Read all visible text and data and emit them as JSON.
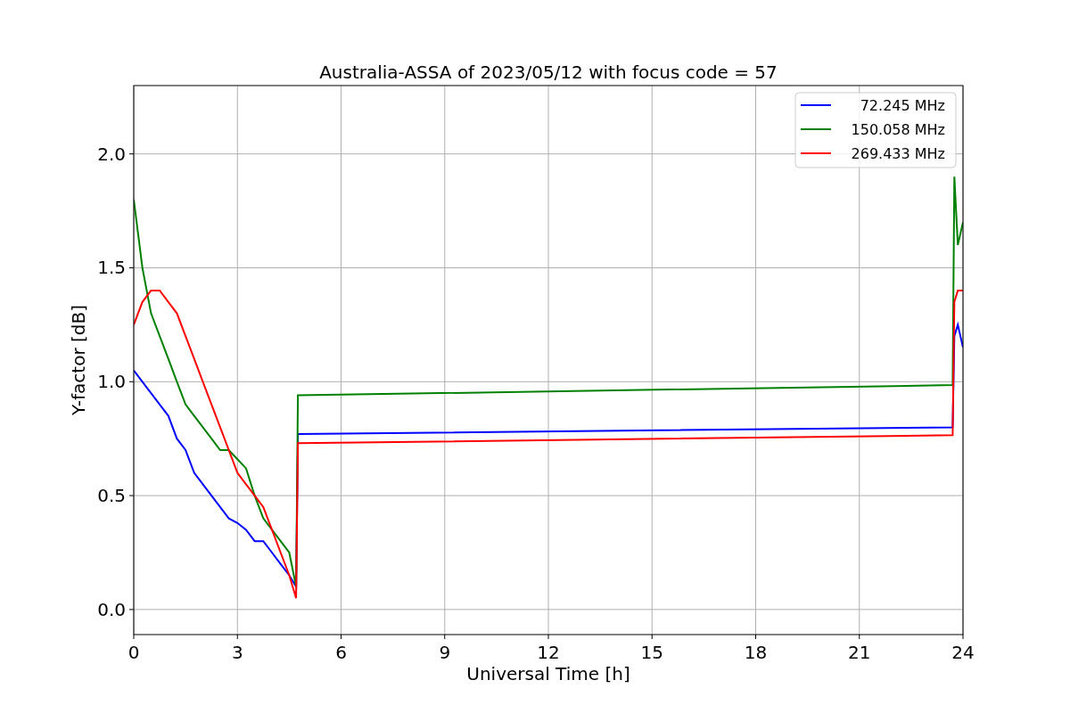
{
  "chart_data": {
    "type": "line",
    "title": "Australia-ASSA of 2023/05/12 with focus code = 57",
    "xlabel": "Universal Time [h]",
    "ylabel": "Y-factor [dB]",
    "x": [
      0,
      0.25,
      0.5,
      0.75,
      1,
      1.25,
      1.5,
      1.75,
      2,
      2.25,
      2.5,
      2.75,
      3,
      3.25,
      3.5,
      3.75,
      4,
      4.25,
      4.5,
      4.7,
      4.75,
      23.7,
      23.75,
      23.85,
      24
    ],
    "series": [
      {
        "name": "72.245 MHz",
        "color": "#0000ff",
        "values": [
          1.05,
          1.0,
          0.95,
          0.9,
          0.85,
          0.75,
          0.7,
          0.6,
          0.55,
          0.5,
          0.45,
          0.4,
          0.38,
          0.35,
          0.3,
          0.3,
          0.25,
          0.2,
          0.15,
          0.1,
          0.77,
          0.8,
          1.2,
          1.25,
          1.15
        ]
      },
      {
        "name": "150.058 MHz",
        "color": "#008000",
        "values": [
          1.8,
          1.5,
          1.3,
          1.2,
          1.1,
          1.0,
          0.9,
          0.85,
          0.8,
          0.75,
          0.7,
          0.7,
          0.66,
          0.62,
          0.5,
          0.4,
          0.35,
          0.3,
          0.25,
          0.1,
          0.94,
          0.985,
          1.9,
          1.6,
          1.7
        ]
      },
      {
        "name": "269.433 MHz",
        "color": "#ff0000",
        "values": [
          1.25,
          1.35,
          1.4,
          1.4,
          1.35,
          1.3,
          1.2,
          1.1,
          1.0,
          0.9,
          0.8,
          0.7,
          0.6,
          0.55,
          0.5,
          0.45,
          0.35,
          0.25,
          0.15,
          0.05,
          0.73,
          0.765,
          1.35,
          1.4,
          1.4
        ]
      }
    ],
    "grid": true,
    "legend": true,
    "xlim": [
      0,
      24
    ],
    "ylim": [
      -0.11,
      2.3
    ],
    "xticks": [
      0,
      3,
      6,
      9,
      12,
      15,
      18,
      21,
      24
    ],
    "yticks": [
      {
        "value": 0,
        "label": "0.0"
      },
      {
        "value": 0.5,
        "label": "0.5"
      },
      {
        "value": 1,
        "label": "1.0"
      },
      {
        "value": 1.5,
        "label": "1.5"
      },
      {
        "value": 2,
        "label": "2.0"
      }
    ]
  }
}
